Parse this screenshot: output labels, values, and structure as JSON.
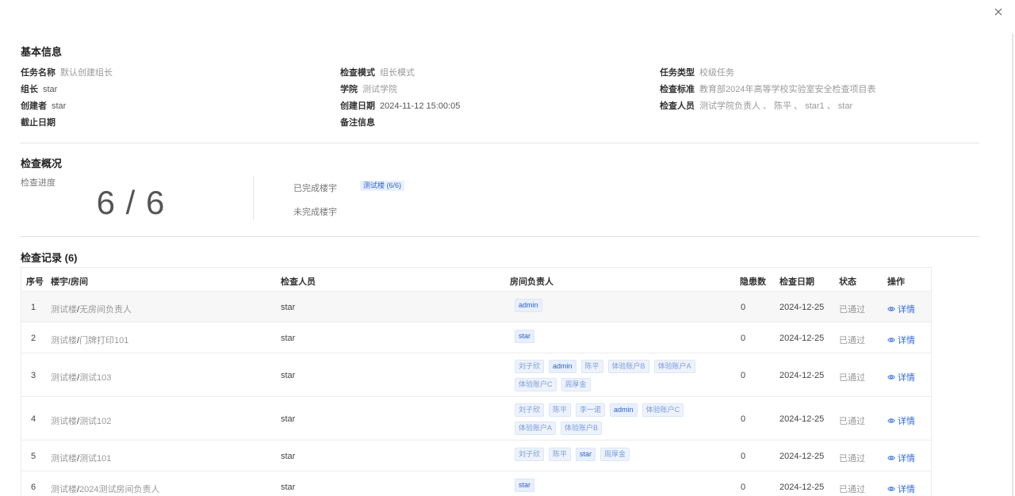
{
  "basic": {
    "title": "基本信息",
    "task_name_label": "任务名称",
    "task_name": "默认创建组长",
    "mode_label": "检查模式",
    "mode": "组长模式",
    "type_label": "任务类型",
    "type": "校级任务",
    "leader_label": "组长",
    "leader": "star",
    "college_label": "学院",
    "college": "测试学院",
    "standard_label": "检查标准",
    "standard": "教育部2024年高等学校实验室安全检查项目表",
    "creator_label": "创建者",
    "creator": "star",
    "created_label": "创建日期",
    "created": "2024-11-12 15:00:05",
    "inspectors_label": "检查人员",
    "inspectors": "测试学院负责人 、 陈平 、 star1 、 star",
    "deadline_label": "截止日期",
    "remark_label": "备注信息"
  },
  "overview": {
    "title": "检查概况",
    "progress_label": "检查进度",
    "progress": "6 / 6",
    "progress_fraction": 1.0,
    "done_label": "已完成楼宇",
    "done_tag": "测试楼 (6/6)",
    "undone_label": "未完成楼宇"
  },
  "records": {
    "title": "检查记录 (6)",
    "headers": {
      "no": "序号",
      "room": "楼宇/房间",
      "inspector": "检查人员",
      "owner": "房间负责人",
      "hazards": "隐患数",
      "date": "检查日期",
      "status": "状态",
      "action": "操作"
    },
    "rows": [
      {
        "no": "1",
        "building": "测试楼",
        "room": "无房间负责人",
        "inspector": "star",
        "owners": [
          "admin"
        ],
        "hazards": "0",
        "date": "2024-12-25",
        "status": "已通过",
        "action": "详情"
      },
      {
        "no": "2",
        "building": "测试楼",
        "room": "门牌打印101",
        "inspector": "star",
        "owners": [
          "star"
        ],
        "hazards": "0",
        "date": "2024-12-25",
        "status": "已通过",
        "action": "详情"
      },
      {
        "no": "3",
        "building": "测试楼",
        "room": "测试103",
        "inspector": "star",
        "owners": [
          "刘子欣",
          "admin",
          "陈平",
          "体验账户B",
          "体验账户A",
          "体验账户C",
          "周厚金"
        ],
        "hazards": "0",
        "date": "2024-12-25",
        "status": "已通过",
        "action": "详情"
      },
      {
        "no": "4",
        "building": "测试楼",
        "room": "测试102",
        "inspector": "star",
        "owners": [
          "刘子欣",
          "陈平",
          "李一诺",
          "admin",
          "体验账户C",
          "体验账户A",
          "体验账户B"
        ],
        "hazards": "0",
        "date": "2024-12-25",
        "status": "已通过",
        "action": "详情"
      },
      {
        "no": "5",
        "building": "测试楼",
        "room": "测试101",
        "inspector": "star",
        "owners": [
          "刘子欣",
          "陈平",
          "star",
          "周厚金"
        ],
        "hazards": "0",
        "date": "2024-12-25",
        "status": "已通过",
        "action": "详情"
      },
      {
        "no": "6",
        "building": "测试楼",
        "room": "2024测试房间负责人",
        "inspector": "star",
        "owners": [
          "star"
        ],
        "hazards": "0",
        "date": "2024-12-25",
        "status": "已通过",
        "action": "详情"
      }
    ]
  }
}
